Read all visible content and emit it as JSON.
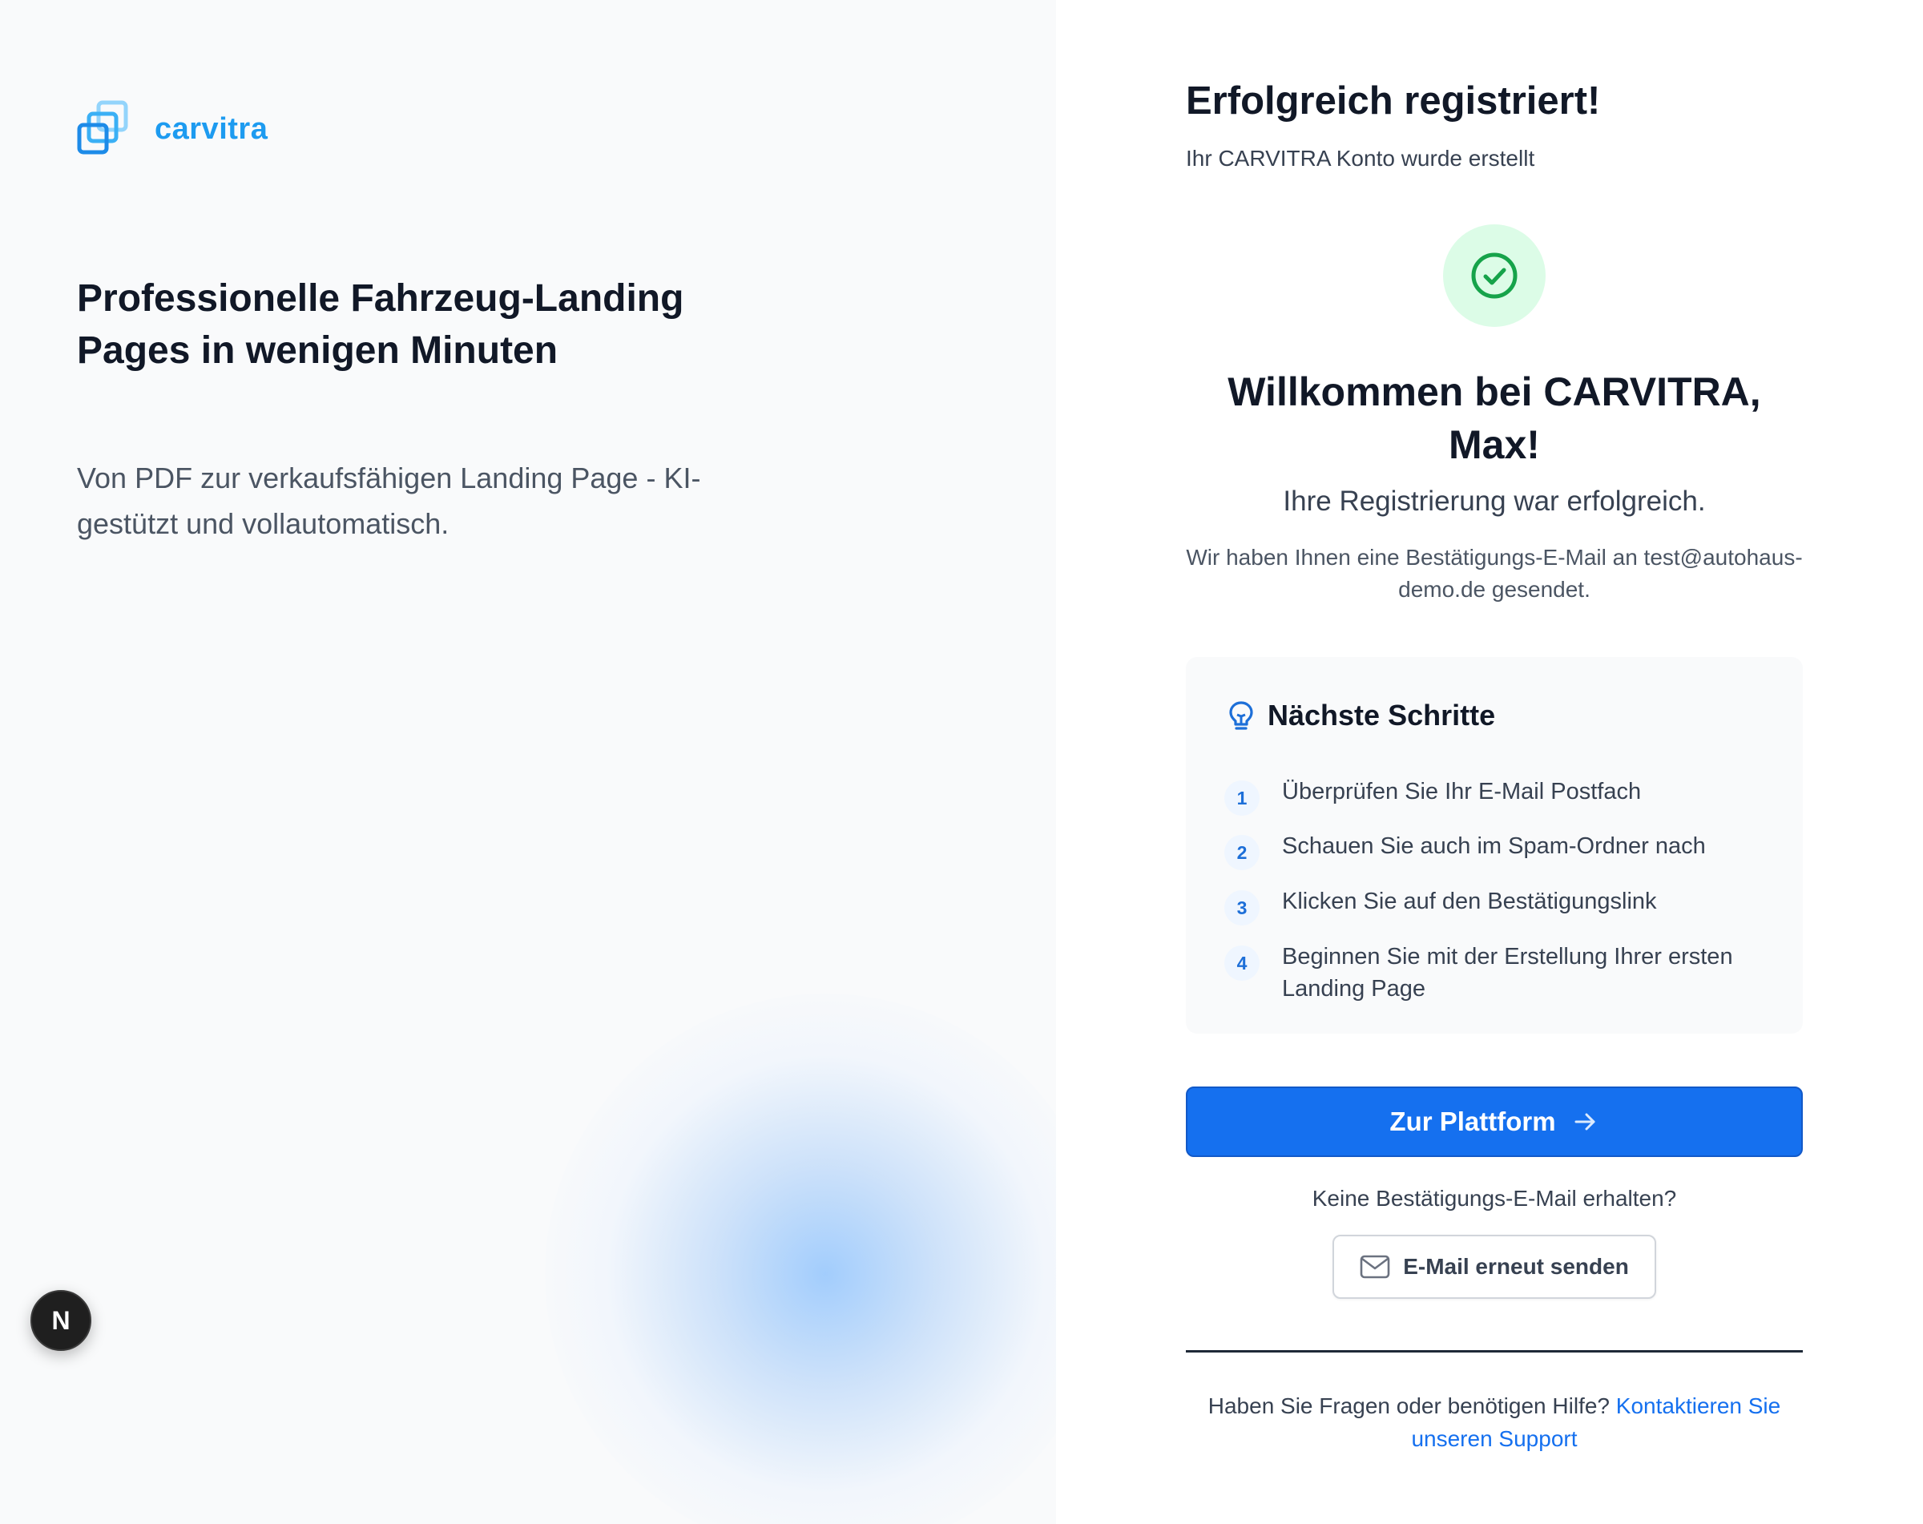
{
  "brand": {
    "name": "carvitra",
    "accent_color": "#1d9bf0"
  },
  "hero": {
    "title": "Professionelle Fahrzeug-Landing Pages in wenigen Minuten",
    "subtitle": "Von PDF zur verkaufsfähigen Landing Page - KI-gestützt und vollautomatisch."
  },
  "dev_badge": {
    "label": "N"
  },
  "confirmation": {
    "title": "Erfolgreich registriert!",
    "subtitle": "Ihr CARVITRA Konto wurde erstellt",
    "success_icon": "check-circle-icon",
    "welcome": "Willkommen bei CARVITRA, Max!",
    "registration_ok": "Ihre Registrierung war erfolgreich.",
    "mail_info": "Wir haben Ihnen eine Bestätigungs-E-Mail an test@autohaus-demo.de gesendet."
  },
  "next_steps": {
    "icon": "lightbulb-icon",
    "title": "Nächste Schritte",
    "items": [
      {
        "number": "1",
        "text": "Überprüfen Sie Ihr E-Mail Postfach"
      },
      {
        "number": "2",
        "text": "Schauen Sie auch im Spam-Ordner nach"
      },
      {
        "number": "3",
        "text": "Klicken Sie auf den Bestätigungslink"
      },
      {
        "number": "4",
        "text": "Beginnen Sie mit der Erstellung Ihrer ersten Landing Page"
      }
    ]
  },
  "actions": {
    "platform_button": "Zur Plattform",
    "platform_button_color": "#1570ef",
    "no_mail_text": "Keine Bestätigungs-E-Mail erhalten?",
    "resend_button": "E-Mail erneut senden"
  },
  "help": {
    "question": "Haben Sie Fragen oder benötigen Hilfe?",
    "link": "Kontaktieren Sie unseren Support"
  }
}
